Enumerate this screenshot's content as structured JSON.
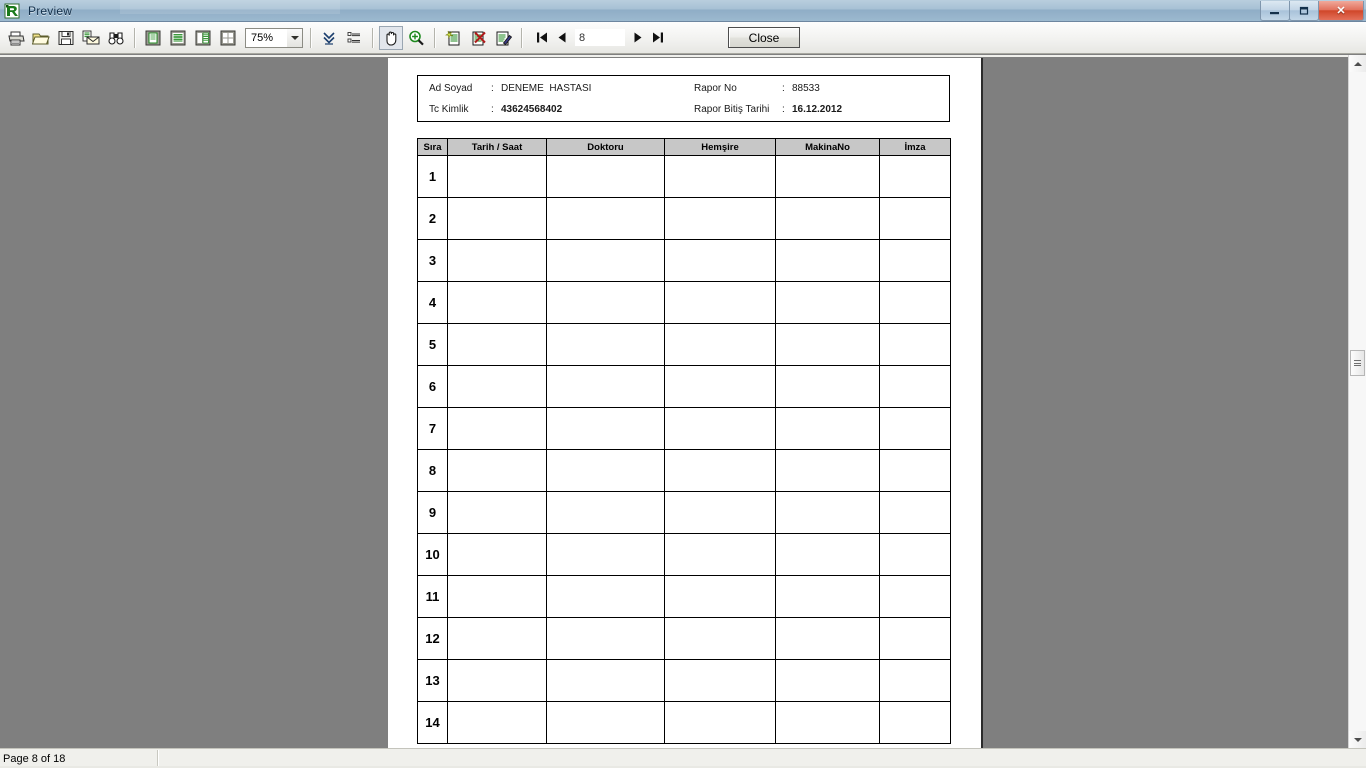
{
  "window": {
    "title": "Preview",
    "icon": "app-logo-r-icon",
    "minimize_label": "–",
    "maximize_label": "❐",
    "close_label": "✕"
  },
  "toolbar": {
    "buttons": [
      {
        "name": "print-icon",
        "title": "Print"
      },
      {
        "name": "open-folder-icon",
        "title": "Open"
      },
      {
        "name": "save-icon",
        "title": "Save"
      },
      {
        "name": "export-mail-icon",
        "title": "Export"
      },
      {
        "name": "find-binoculars-icon",
        "title": "Find"
      },
      {
        "name": "view-single-page-icon",
        "title": "Whole Page"
      },
      {
        "name": "view-page-width-icon",
        "title": "Page Width"
      },
      {
        "name": "view-two-pages-icon",
        "title": "Two Pages"
      },
      {
        "name": "view-multi-pages-icon",
        "title": "Multiple Pages"
      },
      {
        "name": "collapse-all-icon",
        "title": "Collapse"
      },
      {
        "name": "outline-tree-icon",
        "title": "Outline"
      },
      {
        "name": "hand-tool-icon",
        "title": "Hand Tool"
      },
      {
        "name": "zoom-tool-icon",
        "title": "Zoom Tool"
      },
      {
        "name": "new-report-icon",
        "title": "New"
      },
      {
        "name": "delete-report-icon",
        "title": "Delete"
      },
      {
        "name": "edit-report-icon",
        "title": "Edit"
      }
    ],
    "zoom_value": "75%",
    "close_label": "Close"
  },
  "navigation": {
    "first_label": "⏮",
    "prev_label": "◀",
    "next_label": "▶",
    "last_label": "⏭",
    "page_value": "8",
    "page_placeholder": ""
  },
  "report": {
    "header": {
      "left": [
        {
          "label": "Ad Soyad",
          "colon": ":",
          "value": "DENEME  HASTASI",
          "bold": false
        },
        {
          "label": "Tc Kimlik",
          "colon": ":",
          "value": "43624568402",
          "bold": true
        }
      ],
      "right": [
        {
          "label": "Rapor No",
          "colon": ":",
          "value": "88533",
          "bold": false
        },
        {
          "label": "Rapor Bitiş Tarihi",
          "colon": ":",
          "value": "16.12.2012",
          "bold": true
        }
      ]
    },
    "columns": [
      "Sıra",
      "Tarih / Saat",
      "Doktoru",
      "Hemşire",
      "MakinaNo",
      "İmza"
    ],
    "rows": [
      {
        "idx": "1",
        "cells": [
          "",
          "",
          "",
          "",
          ""
        ]
      },
      {
        "idx": "2",
        "cells": [
          "",
          "",
          "",
          "",
          ""
        ]
      },
      {
        "idx": "3",
        "cells": [
          "",
          "",
          "",
          "",
          ""
        ]
      },
      {
        "idx": "4",
        "cells": [
          "",
          "",
          "",
          "",
          ""
        ]
      },
      {
        "idx": "5",
        "cells": [
          "",
          "",
          "",
          "",
          ""
        ]
      },
      {
        "idx": "6",
        "cells": [
          "",
          "",
          "",
          "",
          ""
        ]
      },
      {
        "idx": "7",
        "cells": [
          "",
          "",
          "",
          "",
          ""
        ]
      },
      {
        "idx": "8",
        "cells": [
          "",
          "",
          "",
          "",
          ""
        ]
      },
      {
        "idx": "9",
        "cells": [
          "",
          "",
          "",
          "",
          ""
        ]
      },
      {
        "idx": "10",
        "cells": [
          "",
          "",
          "",
          "",
          ""
        ]
      },
      {
        "idx": "11",
        "cells": [
          "",
          "",
          "",
          "",
          ""
        ]
      },
      {
        "idx": "12",
        "cells": [
          "",
          "",
          "",
          "",
          ""
        ]
      },
      {
        "idx": "13",
        "cells": [
          "",
          "",
          "",
          "",
          ""
        ]
      },
      {
        "idx": "14",
        "cells": [
          "",
          "",
          "",
          "",
          ""
        ]
      }
    ]
  },
  "statusbar": {
    "page_status": "Page 8 of 18",
    "second_panel": ""
  },
  "colors": {
    "page_background": "#7f7f7f",
    "table_header": "#c7c7c7",
    "titlebar_accent": "#a6c0d4",
    "close_button_red": "#cf4528"
  }
}
